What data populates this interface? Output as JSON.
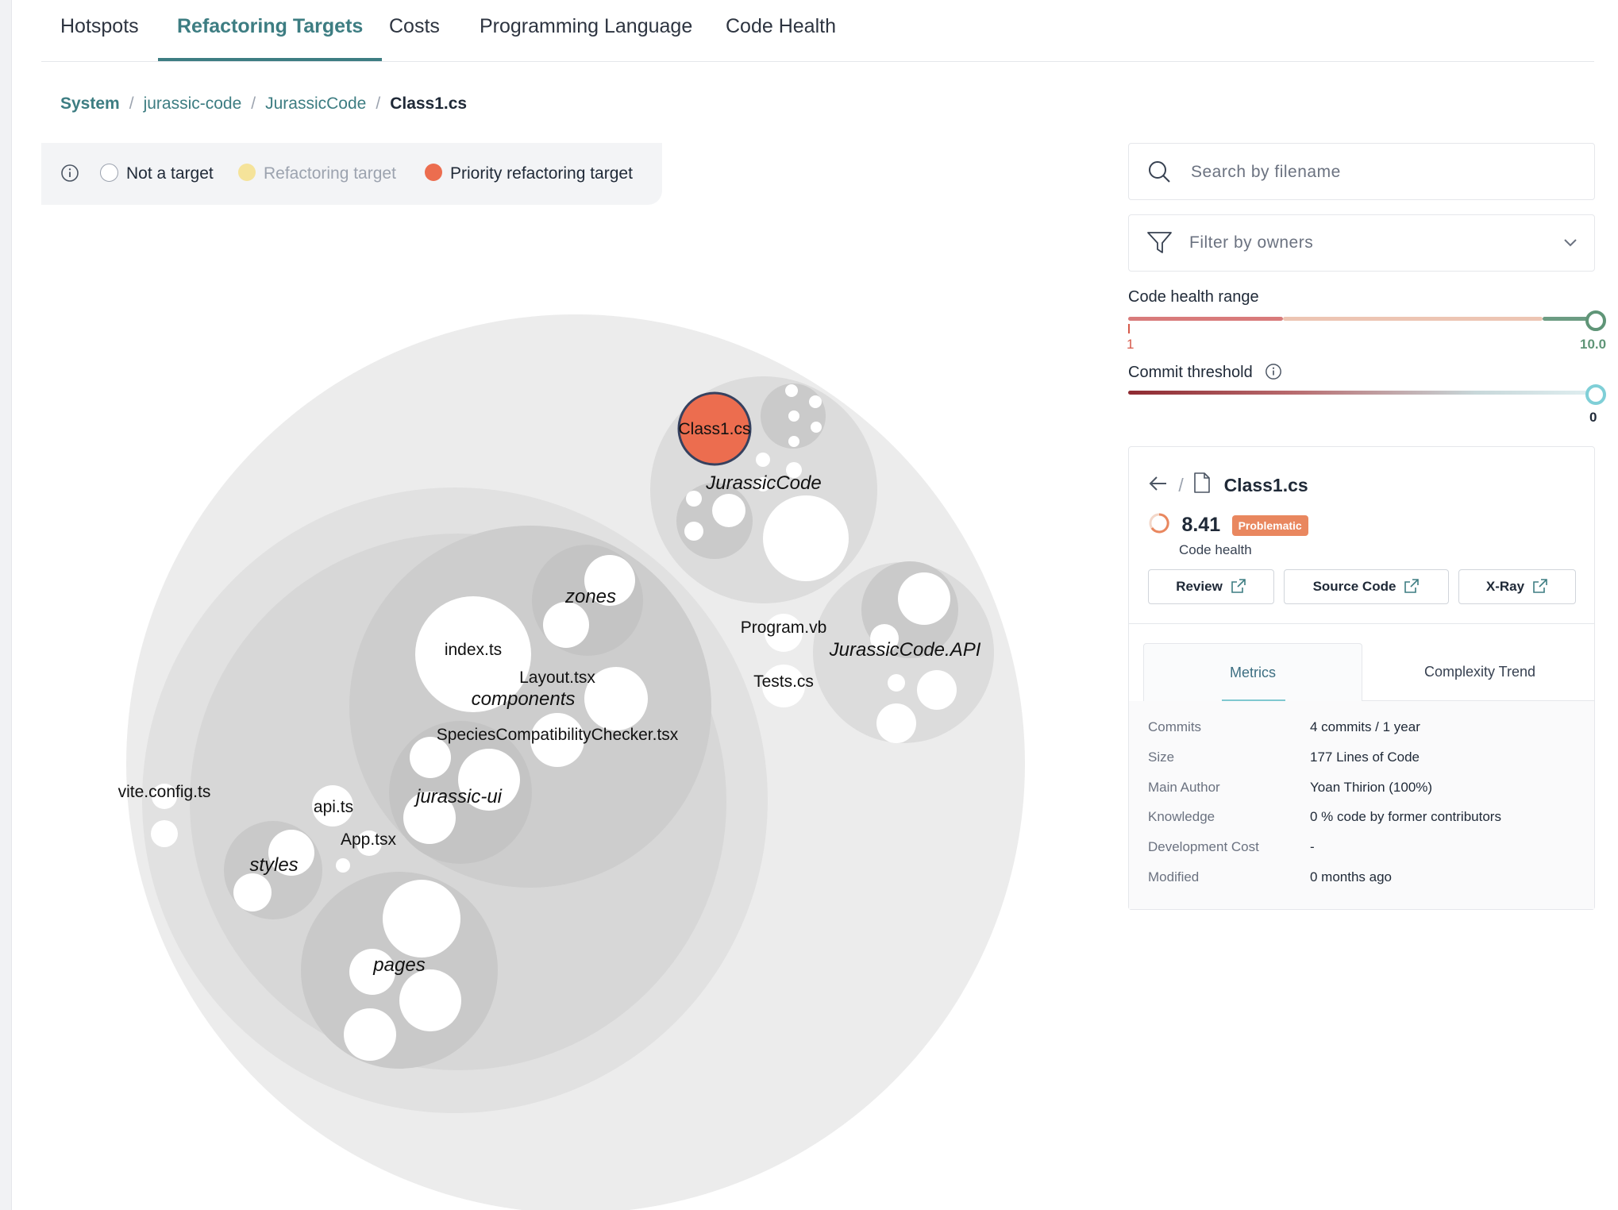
{
  "tabs": [
    {
      "label": "Hotspots",
      "active": false
    },
    {
      "label": "Refactoring Targets",
      "active": true
    },
    {
      "label": "Costs",
      "active": false
    },
    {
      "label": "Programming Language",
      "active": false
    },
    {
      "label": "Code Health",
      "active": false
    }
  ],
  "breadcrumb": [
    "System",
    "jurassic-code",
    "JurassicCode",
    "Class1.cs"
  ],
  "legend": {
    "icon": "info-icon",
    "items": [
      {
        "label": "Not a target",
        "color": "#ffffff"
      },
      {
        "label": "Refactoring target",
        "color": "#f5e39a"
      },
      {
        "label": "Priority refactoring target",
        "color": "#ec6d4f"
      }
    ]
  },
  "chart_labels": {
    "files": {
      "class1": "Class1.cs",
      "program_vb": "Program.vb",
      "tests_cs": "Tests.cs",
      "index_ts": "index.ts",
      "layout_tsx": "Layout.tsx",
      "species": "SpeciesCompatibilityChecker.tsx",
      "vite_config": "vite.config.ts",
      "api_ts": "api.ts",
      "app_tsx": "App.tsx"
    },
    "folders": {
      "jurassiccode": "JurassicCode",
      "jurassiccode_api": "JurassicCode.API",
      "zones": "zones",
      "components": "components",
      "jurassic_ui": "jurassic-ui",
      "styles": "styles",
      "pages": "pages"
    }
  },
  "colors": {
    "accent": "#3d7d82",
    "priority_target": "#ec6d4f",
    "refactoring_target": "#f5e39a",
    "problematic_badge": "#e9875f"
  },
  "search": {
    "placeholder": "Search by filename",
    "icon": "search-icon"
  },
  "filter": {
    "placeholder": "Filter by owners",
    "icon": "filter-icon"
  },
  "code_health_range": {
    "label": "Code health range",
    "min_label": "1",
    "max_label": "10.0",
    "min": 1,
    "max": 10.0
  },
  "commit_threshold": {
    "label": "Commit threshold",
    "value_label": "0",
    "value": 0
  },
  "file_card": {
    "filename": "Class1.cs",
    "score": "8.41",
    "badge": "Problematic",
    "score_label": "Code health",
    "buttons": {
      "review": "Review",
      "source": "Source Code",
      "xray": "X-Ray"
    },
    "subtabs": {
      "metrics": "Metrics",
      "trend": "Complexity Trend"
    },
    "metrics": [
      {
        "key": "Commits",
        "value": "4 commits / 1 year"
      },
      {
        "key": "Size",
        "value": "177 Lines of Code"
      },
      {
        "key": "Main Author",
        "value": "Yoan Thirion (100%)"
      },
      {
        "key": "Knowledge",
        "value": "0 % code by former contributors"
      },
      {
        "key": "Development Cost",
        "value": "-"
      },
      {
        "key": "Modified",
        "value": "0 months ago"
      }
    ]
  }
}
